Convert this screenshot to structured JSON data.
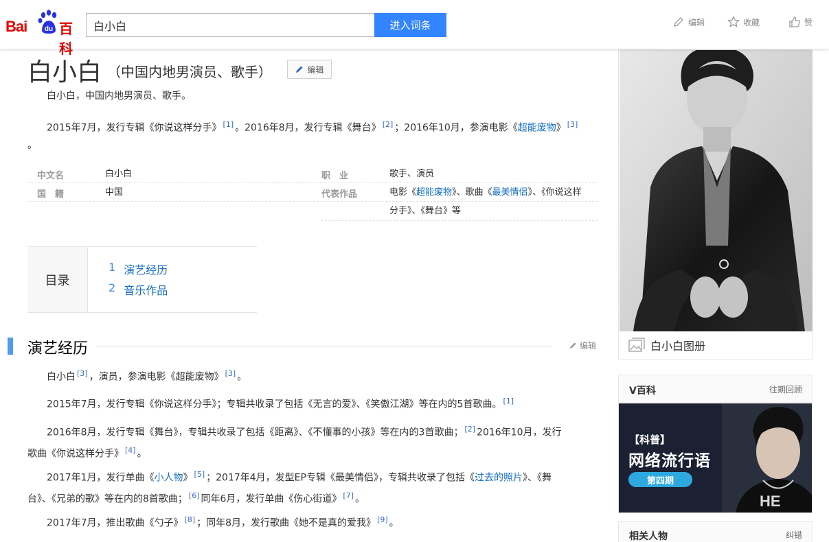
{
  "header": {
    "logo_text_bai": "Bai",
    "logo_text_du": "du",
    "logo_text_baike": "百科",
    "search_value": "白小白",
    "search_button": "进入词条",
    "actions": [
      {
        "label": "编辑",
        "icon": "pencil-icon"
      },
      {
        "label": "收藏",
        "icon": "star-icon"
      },
      {
        "label": "赞",
        "icon": "thumbs-up-icon"
      }
    ]
  },
  "title": {
    "main": "白小白",
    "sub": "（中国内地男演员、歌手）",
    "edit": "编辑"
  },
  "summary": {
    "line1": "白小白，中国内地男演员、歌手。",
    "line2_a": "2015年7月，发行专辑《你说这样分手》",
    "ref1": "[1]",
    "line2_b": "。2016年8月，发行专辑《舞台》",
    "ref2": "[2]",
    "line2_c": "；2016年10月，参演电影《",
    "link_film": "超能废物",
    "line2_d": "》",
    "ref3": "[3]",
    "line2_e": "。"
  },
  "basic_info": {
    "rows": [
      {
        "k1": "中文名",
        "v1": "白小白",
        "k2": "职　业",
        "v2": "歌手、演员"
      },
      {
        "k1": "国　籍",
        "v1": "中国",
        "k2": "代表作品"
      }
    ],
    "works_a": "电影《",
    "works_link1": "超能废物",
    "works_b": "》、歌曲《",
    "works_link2": "最美情侣",
    "works_c": "》、《你说这样",
    "works_line2": "分手》、《舞台》等"
  },
  "catalog": {
    "title": "目录",
    "items": [
      {
        "num": "1",
        "label": "演艺经历"
      },
      {
        "num": "2",
        "label": "音乐作品"
      }
    ]
  },
  "section": {
    "title": "演艺经历",
    "edit": "编辑",
    "p1_a": "白小白",
    "p1_ref": "[3]",
    "p1_b": "，演员，参演电影《超能废物》",
    "p1_ref2": "[3]",
    "p1_c": "。",
    "p2_a": "2015年7月，发行专辑《你说这样分手》；专辑共收录了包括《无言的爱》、《笑傲江湖》等在内的5首歌曲。",
    "p2_ref": "[1]",
    "p3_a": "2016年8月，发行专辑《舞台》，专辑共收录了包括《距离》、《不懂事的小孩》等在内的3首歌曲；",
    "p3_ref": "[2]",
    "p3_b": "2016年10月，发行",
    "p3_c": "歌曲《你说这样分手》",
    "p3_ref2": "[4]",
    "p3_d": "。",
    "p4_a": "2017年1月，发行单曲《",
    "p4_link1": "小人物",
    "p4_b": "》",
    "p4_ref1": "[5]",
    "p4_c": "；2017年4月，发型EP专辑《最美情侣》，专辑共收录了包括《",
    "p4_link2": "过去的照片",
    "p4_d": "》、《舞",
    "p4_e": "台》、《兄弟的歌》等在内的8首歌曲；",
    "p4_ref2": "[6]",
    "p4_f": "同年6月，发行单曲《伤心街道》",
    "p4_ref3": "[7]",
    "p4_g": "。",
    "p5_a": "2017年7月，推出歌曲《勺子》",
    "p5_ref1": "[8]",
    "p5_b": "；同年8月，发行歌曲《她不是真的爱我》",
    "p5_ref2": "[9]",
    "p5_c": "。"
  },
  "sidebar": {
    "album_label": "白小白图册",
    "vbaike_title": "V百科",
    "vbaike_more": "往期回顾",
    "banner_tag": "【科普】",
    "banner_headline": "网络流行语",
    "banner_pill": "第四期",
    "related_title": "相关人物",
    "related_more": "纠错"
  },
  "colors": {
    "brand_red": "#e10602",
    "brand_blue": "#3385ff",
    "link": "#136ec2",
    "section_bar": "#4f9cee"
  }
}
